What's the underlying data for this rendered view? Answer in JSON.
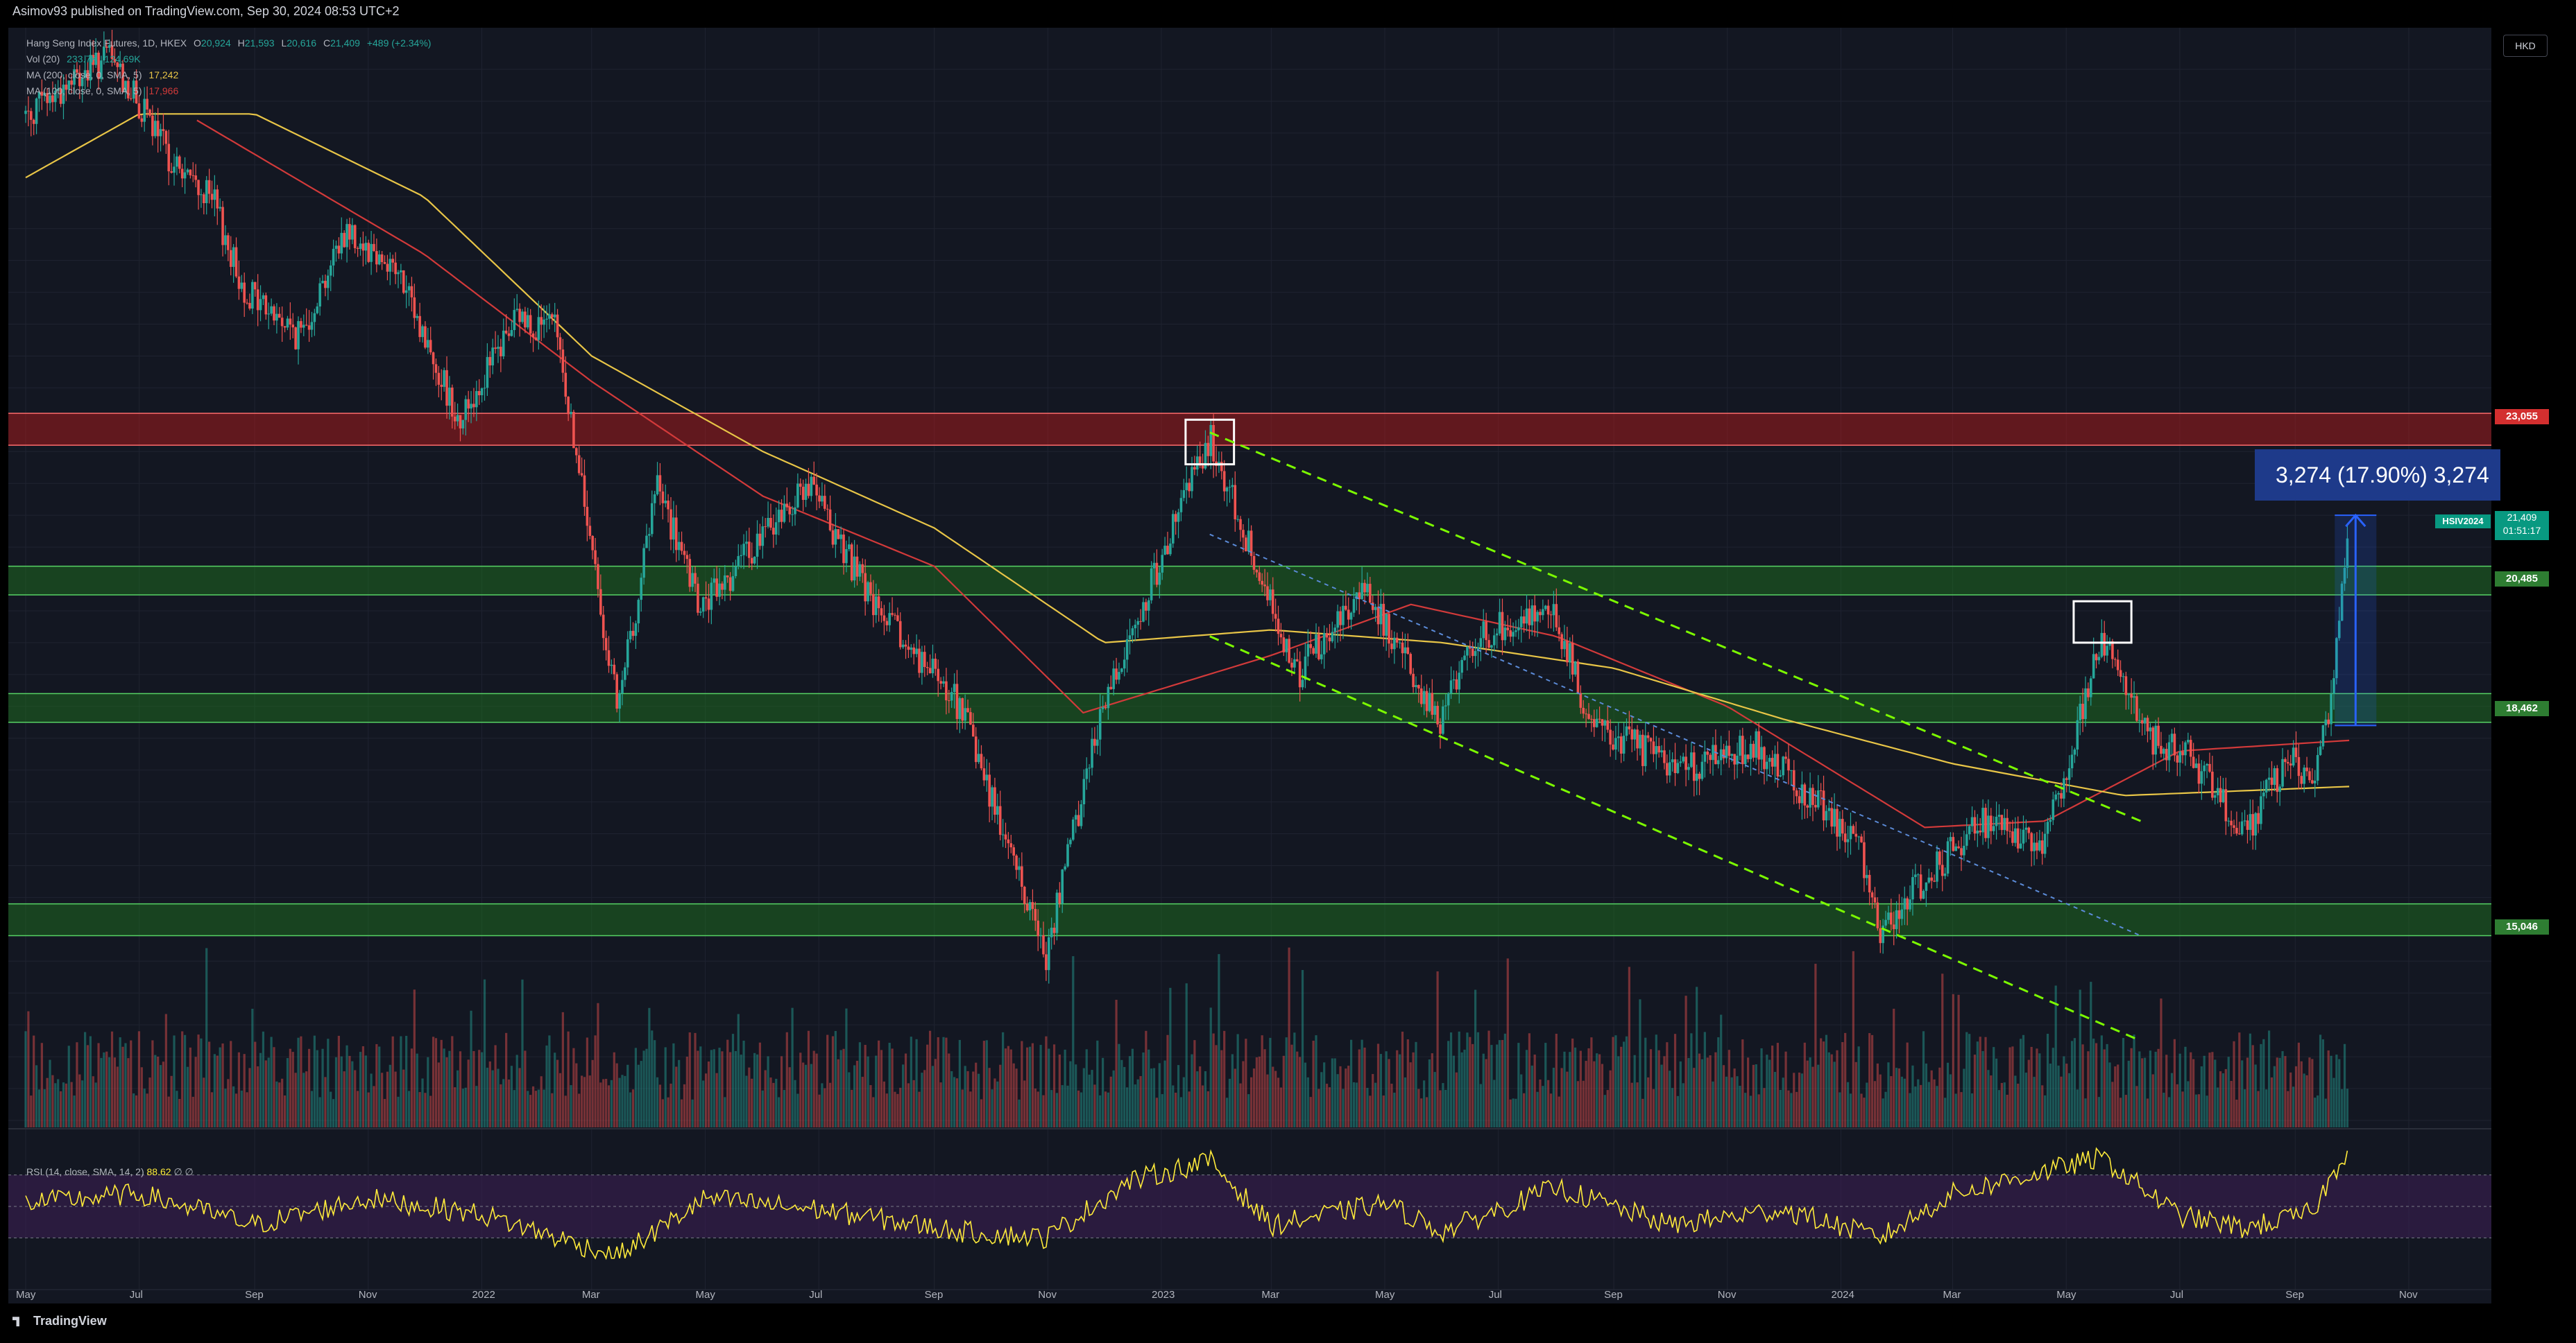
{
  "header": {
    "published": "Asimov93 published on TradingView.com, Sep 30, 2024 08:53 UTC+2"
  },
  "legend": {
    "symbol_label": "Hang Seng Index Futures, 1D, HKEX",
    "o_label": "O",
    "o": "20,924",
    "h_label": "H",
    "h": "21,593",
    "l_label": "L",
    "l": "20,616",
    "c_label": "C",
    "c": "21,409",
    "change": "+489 (+2.34%)",
    "vol_label": "Vol (20)",
    "vol_1": "233.7K",
    "vol_2": "124.69K",
    "ma200_label": "MA (200, close, 0, SMA, 5)",
    "ma200_value": "17,242",
    "ma100_label": "MA (100, close, 0, SMA, 5)",
    "ma100_value": "17,966",
    "rsi_label": "RSI (14, close, SMA, 14, 2)",
    "rsi_value": "88.62",
    "rsi_extra": "∅ ∅"
  },
  "currency": "HKD",
  "measurement_label": "3,274 (17.90%) 3,274",
  "symbol_tag": "HSIV2024",
  "badges": {
    "last_price": "21,409",
    "countdown": "01:51:17",
    "r_23055": "23,055",
    "s_20485": "20,485",
    "s_18462": "18,462",
    "s_15046": "15,046"
  },
  "footer": {
    "brand": "TradingView"
  },
  "colors": {
    "background": "#131722",
    "grid": "#1f2330",
    "up": "#26a69a",
    "down": "#ef5350",
    "ma100": "#d23a3a",
    "ma200": "#e8c547",
    "rsi": "#ffeb3b",
    "rsi_band": "#3a1e52",
    "resistance_zone": "#c21a1a",
    "support_zone": "#1f7a1f",
    "channel": "#7cfc00",
    "measure": "#2962ff"
  },
  "chart_data": {
    "type": "candlestick",
    "instrument": "Hang Seng Index Futures",
    "interval": "1D",
    "exchange": "HKEX",
    "price_axis": {
      "ticks": [
        28500,
        28000,
        27500,
        27000,
        26500,
        26000,
        25500,
        25000,
        24500,
        24000,
        23500,
        22500,
        22000,
        21500,
        21000,
        20000,
        19500,
        19000,
        18500,
        18000,
        17500,
        17000,
        16500,
        16000,
        15500,
        14500,
        14000,
        13500,
        13000,
        12500,
        12000
      ],
      "range": [
        11950,
        28750
      ]
    },
    "time_axis": {
      "ticks": [
        "May",
        "Jul",
        "Sep",
        "Nov",
        "2022",
        "Mar",
        "May",
        "Jul",
        "Sep",
        "Nov",
        "2023",
        "Mar",
        "May",
        "Jul",
        "Sep",
        "Nov",
        "2024",
        "Mar",
        "May",
        "Jul",
        "Sep",
        "Nov"
      ]
    },
    "close_path": [
      [
        "2021-05-01",
        27800
      ],
      [
        "2021-06-15",
        28700
      ],
      [
        "2021-07-20",
        27000
      ],
      [
        "2021-08-10",
        26400
      ],
      [
        "2021-08-25",
        25100
      ],
      [
        "2021-09-25",
        24300
      ],
      [
        "2021-10-20",
        26000
      ],
      [
        "2021-11-15",
        25400
      ],
      [
        "2021-12-20",
        23000
      ],
      [
        "2022-01-20",
        24600
      ],
      [
        "2022-02-10",
        24400
      ],
      [
        "2022-03-15",
        18400
      ],
      [
        "2022-04-05",
        22000
      ],
      [
        "2022-04-28",
        20000
      ],
      [
        "2022-06-25",
        22000
      ],
      [
        "2022-08-01",
        20000
      ],
      [
        "2022-09-15",
        18500
      ],
      [
        "2022-10-31",
        14600
      ],
      [
        "2022-11-30",
        18500
      ],
      [
        "2023-01-27",
        22700
      ],
      [
        "2023-03-15",
        19000
      ],
      [
        "2023-04-20",
        20400
      ],
      [
        "2023-05-31",
        18200
      ],
      [
        "2023-06-15",
        19500
      ],
      [
        "2023-07-30",
        20100
      ],
      [
        "2023-08-20",
        18200
      ],
      [
        "2023-10-10",
        17500
      ],
      [
        "2023-11-15",
        17900
      ],
      [
        "2024-01-10",
        16400
      ],
      [
        "2024-01-22",
        15000
      ],
      [
        "2024-03-15",
        16700
      ],
      [
        "2024-04-20",
        16400
      ],
      [
        "2024-05-20",
        19600
      ],
      [
        "2024-06-15",
        18000
      ],
      [
        "2024-07-05",
        17800
      ],
      [
        "2024-08-05",
        16500
      ],
      [
        "2024-08-30",
        17800
      ],
      [
        "2024-09-10",
        17200
      ],
      [
        "2024-09-20",
        18500
      ],
      [
        "2024-09-30",
        21409
      ]
    ],
    "last": {
      "open": 20924,
      "high": 21593,
      "low": 20616,
      "close": 21409,
      "change": 489,
      "change_pct": 2.34
    },
    "moving_averages": {
      "ma100": {
        "label": "MA (100, close, 0, SMA, 5)",
        "value": 17966,
        "path": [
          [
            "2021-08-01",
            27700
          ],
          [
            "2021-12-01",
            25600
          ],
          [
            "2022-03-01",
            23600
          ],
          [
            "2022-06-01",
            21800
          ],
          [
            "2022-09-01",
            20700
          ],
          [
            "2022-11-20",
            18400
          ],
          [
            "2023-03-01",
            19300
          ],
          [
            "2023-05-15",
            20100
          ],
          [
            "2023-08-01",
            19600
          ],
          [
            "2023-11-01",
            18500
          ],
          [
            "2024-02-15",
            16600
          ],
          [
            "2024-04-20",
            16700
          ],
          [
            "2024-07-01",
            17800
          ],
          [
            "2024-09-30",
            17966
          ]
        ]
      },
      "ma200": {
        "label": "MA (200, close, 0, SMA, 5)",
        "value": 17242,
        "path": [
          [
            "2021-05-01",
            26800
          ],
          [
            "2021-07-01",
            27800
          ],
          [
            "2021-09-01",
            27800
          ],
          [
            "2021-12-01",
            26500
          ],
          [
            "2022-03-01",
            24000
          ],
          [
            "2022-06-01",
            22500
          ],
          [
            "2022-09-01",
            21300
          ],
          [
            "2022-12-01",
            19500
          ],
          [
            "2023-03-01",
            19700
          ],
          [
            "2023-06-01",
            19500
          ],
          [
            "2023-09-01",
            19100
          ],
          [
            "2023-12-01",
            18300
          ],
          [
            "2024-03-01",
            17600
          ],
          [
            "2024-06-01",
            17100
          ],
          [
            "2024-09-30",
            17242
          ]
        ]
      }
    },
    "zones": [
      {
        "kind": "resistance",
        "low": 22600,
        "high": 23100,
        "label": "23,055"
      },
      {
        "kind": "support",
        "low": 20250,
        "high": 20700,
        "label": "20,485"
      },
      {
        "kind": "support",
        "low": 18250,
        "high": 18700,
        "label": "18,462"
      },
      {
        "kind": "support",
        "low": 14900,
        "high": 15400,
        "label": "15,046"
      }
    ],
    "annotations": [
      {
        "type": "box",
        "from": "2023-01-14",
        "to": "2023-02-09",
        "low": 22300,
        "high": 23000
      },
      {
        "type": "box",
        "from": "2024-05-05",
        "to": "2024-06-05",
        "low": 19500,
        "high": 20150
      },
      {
        "type": "dashed-line",
        "style": "channel",
        "from": [
          "2023-01-27",
          22800
        ],
        "to": [
          "2024-06-10",
          16700
        ]
      },
      {
        "type": "dashed-line",
        "style": "channel",
        "from": [
          "2023-01-27",
          19600
        ],
        "to": [
          "2024-06-10",
          13250
        ]
      },
      {
        "type": "dashed-line",
        "style": "mid",
        "from": [
          "2023-01-27",
          21200
        ],
        "to": [
          "2024-06-10",
          14900
        ]
      },
      {
        "type": "measure",
        "from": [
          "2024-09-20",
          18200
        ],
        "to": [
          "2024-09-20",
          21500
        ],
        "label": "3,274 (17.90%) 3,274"
      }
    ],
    "volume": {
      "label": "Vol (20)",
      "values_shown": [
        "233.7K",
        "124.69K"
      ]
    },
    "rsi": {
      "label": "RSI (14, close, SMA, 14, 2)",
      "value": 88.62,
      "ticks": [
        80.0,
        60.0,
        40.0,
        20.0
      ],
      "range": [
        16,
        92
      ],
      "upper_band": 70,
      "lower_band": 30,
      "path": [
        [
          "2021-05-01",
          52
        ],
        [
          "2021-07-01",
          58
        ],
        [
          "2021-09-01",
          38
        ],
        [
          "2021-11-01",
          55
        ],
        [
          "2022-01-01",
          45
        ],
        [
          "2022-03-15",
          18
        ],
        [
          "2022-05-01",
          55
        ],
        [
          "2022-07-01",
          48
        ],
        [
          "2022-09-15",
          34
        ],
        [
          "2022-10-31",
          30
        ],
        [
          "2022-12-15",
          66
        ],
        [
          "2023-01-27",
          79
        ],
        [
          "2023-03-01",
          38
        ],
        [
          "2023-05-01",
          52
        ],
        [
          "2023-06-01",
          34
        ],
        [
          "2023-08-01",
          62
        ],
        [
          "2023-10-01",
          38
        ],
        [
          "2023-12-01",
          48
        ],
        [
          "2024-01-22",
          30
        ],
        [
          "2024-03-01",
          58
        ],
        [
          "2024-05-20",
          81
        ],
        [
          "2024-07-01",
          44
        ],
        [
          "2024-08-05",
          36
        ],
        [
          "2024-09-10",
          46
        ],
        [
          "2024-09-30",
          88.62
        ]
      ]
    }
  }
}
